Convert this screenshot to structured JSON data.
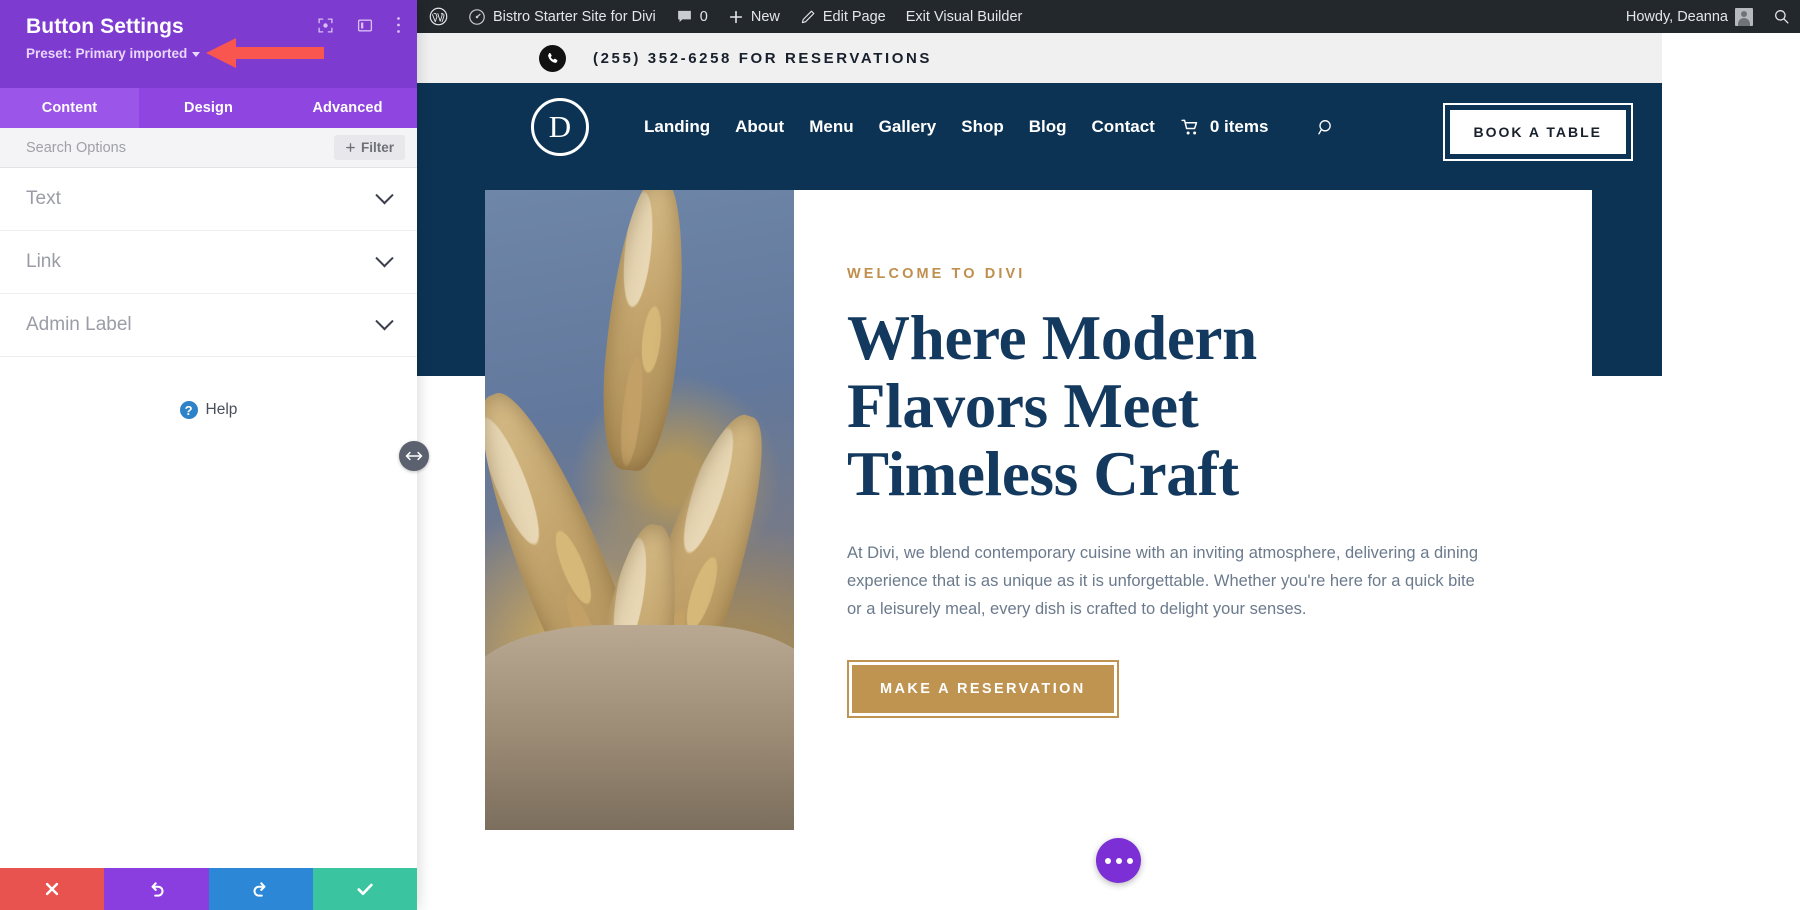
{
  "settings_panel": {
    "title": "Button Settings",
    "preset_label": "Preset: Primary imported",
    "header_icons": [
      {
        "name": "fullscreen-focus-icon"
      },
      {
        "name": "panel-layout-icon"
      },
      {
        "name": "more-vertical-icon"
      }
    ],
    "tabs": [
      {
        "label": "Content",
        "active": true
      },
      {
        "label": "Design",
        "active": false
      },
      {
        "label": "Advanced",
        "active": false
      }
    ],
    "search_placeholder": "Search Options",
    "filter_label": "Filter",
    "toggles": [
      {
        "label": "Text"
      },
      {
        "label": "Link"
      },
      {
        "label": "Admin Label"
      }
    ],
    "help_label": "Help",
    "footer_buttons": [
      {
        "name": "discard-button",
        "icon": "close-icon",
        "color": "#e9534f"
      },
      {
        "name": "undo-button",
        "icon": "undo-icon",
        "color": "#8b3ee0"
      },
      {
        "name": "redo-button",
        "icon": "redo-icon",
        "color": "#2c88d7"
      },
      {
        "name": "save-button",
        "icon": "check-icon",
        "color": "#3bc4a0"
      }
    ],
    "accent_purple": "#7e3bd0",
    "tab_bar_purple": "#8f46e0"
  },
  "annotation": {
    "type": "arrow",
    "color": "#f9564f",
    "points_to": "preset-selector"
  },
  "admin_bar": {
    "site_name": "Bistro Starter Site for Divi",
    "comment_count": "0",
    "new_label": "New",
    "edit_page_label": "Edit Page",
    "exit_builder_label": "Exit Visual Builder",
    "greeting": "Howdy, Deanna",
    "bg": "#23282d"
  },
  "site": {
    "topbar": {
      "phone_text": "(255) 352-6258 FOR RESERVATIONS",
      "bg": "#f0f0f0"
    },
    "nav": {
      "logo_letter": "D",
      "links": [
        "Landing",
        "About",
        "Menu",
        "Gallery",
        "Shop",
        "Blog",
        "Contact"
      ],
      "cart_label": "0 items",
      "cta_label": "BOOK A TABLE",
      "bg": "#0d3354"
    },
    "hero": {
      "eyebrow": "WELCOME TO DIVI",
      "title": "Where Modern Flavors Meet Timeless Craft",
      "paragraph": "At Divi, we blend contemporary cuisine with an inviting atmosphere, delivering a dining experience that is as unique as it is unforgettable. Whether you're here for a quick bite or a leisurely meal, every dish is crafted to delight your senses.",
      "cta_label": "MAKE A RESERVATION",
      "title_color": "#13395e",
      "eyebrow_color": "#bf8f4e",
      "cta_color": "#bf9350",
      "image_alt": "seeded-breadsticks-in-paper-bag"
    }
  }
}
